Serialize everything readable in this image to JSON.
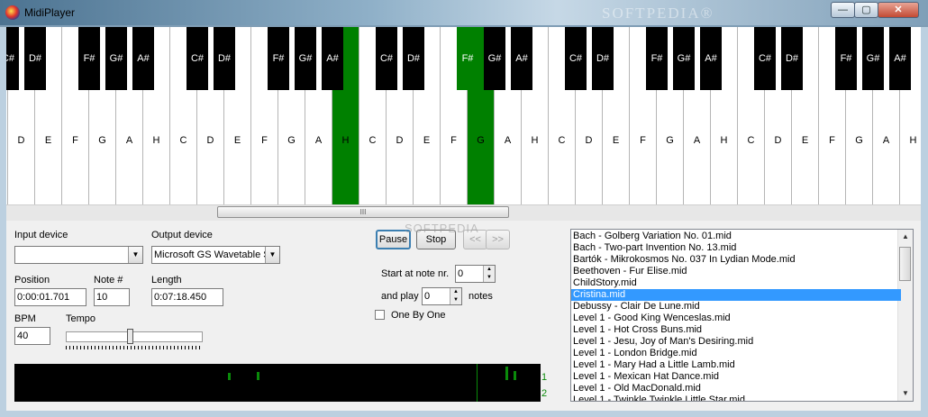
{
  "window": {
    "title": "MidiPlayer",
    "watermark": "SOFTPEDIA®",
    "min_label": "—",
    "max_label": "▢",
    "close_label": "✕"
  },
  "keyboard": {
    "white_keys": [
      "D",
      "E",
      "F",
      "G",
      "A",
      "H",
      "C",
      "D",
      "E",
      "F",
      "G",
      "A",
      "H",
      "C",
      "D",
      "E",
      "F",
      "G",
      "A",
      "H",
      "C",
      "D",
      "E",
      "F",
      "G",
      "A",
      "H",
      "C",
      "D",
      "E",
      "F",
      "G",
      "A",
      "H"
    ],
    "black_keys": [
      "C#",
      "D#",
      "F#",
      "G#",
      "A#",
      "C#",
      "D#",
      "F#",
      "G#",
      "A#",
      "C#",
      "D#",
      "F#",
      "G#",
      "A#",
      "C#",
      "D#",
      "F#",
      "G#",
      "A#",
      "C#",
      "D#",
      "F#",
      "G#",
      "A#",
      "C#",
      "D#",
      "F#",
      "G#",
      "A#"
    ],
    "pressed_white": [
      "H",
      "G"
    ],
    "pressed_black": [
      "G#"
    ],
    "pressed_color": "#008000",
    "scroll_grip": "III"
  },
  "input_device": {
    "label": "Input device",
    "value": ""
  },
  "output_device": {
    "label": "Output device",
    "value": "Microsoft GS Wavetable S"
  },
  "position": {
    "label": "Position",
    "value": "0:00:01.701"
  },
  "note": {
    "label": "Note #",
    "value": "10"
  },
  "length": {
    "label": "Length",
    "value": "0:07:18.450"
  },
  "bpm": {
    "label": "BPM",
    "value": "40"
  },
  "tempo": {
    "label": "Tempo",
    "level": 0.47
  },
  "buttons": {
    "pause": "Pause",
    "stop": "Stop",
    "prev": "<<",
    "next": ">>"
  },
  "start_at": {
    "label": "Start at note nr.",
    "value": "0"
  },
  "play_count": {
    "label": "and play",
    "value": "0",
    "suffix": "notes"
  },
  "one_by_one": {
    "label": "One By One",
    "checked": false
  },
  "watermark_center": "SOFTPEDIA",
  "vu": {
    "channel_1": "1",
    "channel_2": "2"
  },
  "playlist": {
    "items": [
      "Bach - Golberg Variation No. 01.mid",
      "Bach - Two-part Invention No. 13.mid",
      "Bartók - Mikrokosmos No. 037 In Lydian Mode.mid",
      "Beethoven - Fur Elise.mid",
      "ChildStory.mid",
      "Cristina.mid",
      "Debussy - Clair De Lune.mid",
      "Level 1 - Good King Wenceslas.mid",
      "Level 1 - Hot Cross Buns.mid",
      "Level 1 - Jesu, Joy of Man's Desiring.mid",
      "Level 1 - London Bridge.mid",
      "Level 1 - Mary Had a Little Lamb.mid",
      "Level 1 - Mexican Hat Dance.mid",
      "Level 1 - Old MacDonald.mid",
      "Level 1 - Twinkle Twinkle Little Star.mid"
    ],
    "selected_index": 5
  }
}
